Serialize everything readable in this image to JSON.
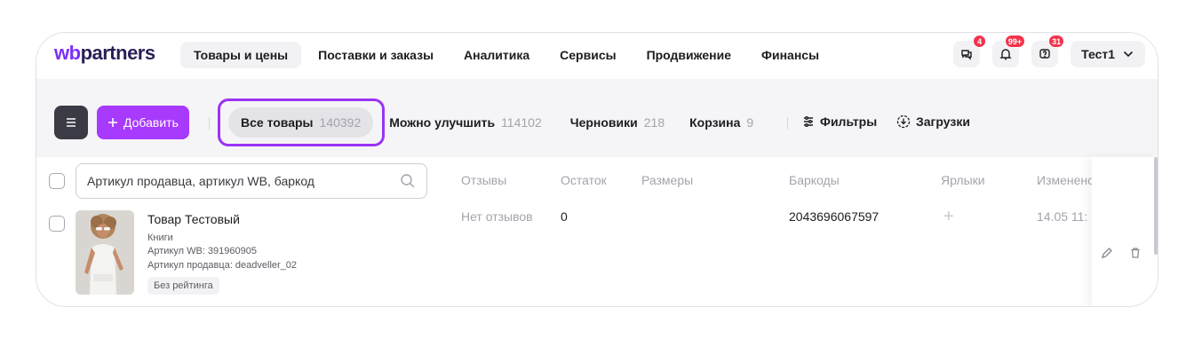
{
  "logo": {
    "part1": "wb",
    "part2": "partners"
  },
  "nav": [
    {
      "label": "Товары и цены",
      "active": true
    },
    {
      "label": "Поставки и заказы",
      "active": false
    },
    {
      "label": "Аналитика",
      "active": false
    },
    {
      "label": "Сервисы",
      "active": false
    },
    {
      "label": "Продвижение",
      "active": false
    },
    {
      "label": "Финансы",
      "active": false
    }
  ],
  "header_icons": [
    {
      "icon": "chat-icon",
      "badge": "4"
    },
    {
      "icon": "bell-icon",
      "badge": "99+"
    },
    {
      "icon": "support-icon",
      "badge": "31"
    }
  ],
  "user": {
    "name": "Тест1"
  },
  "toolbar": {
    "add_label": "Добавить",
    "tabs": [
      {
        "label": "Все товары",
        "count": "140392",
        "active": true
      },
      {
        "label": "Можно улучшить",
        "count": "114102",
        "active": false
      },
      {
        "label": "Черновики",
        "count": "218",
        "active": false
      },
      {
        "label": "Корзина",
        "count": "9",
        "active": false
      }
    ],
    "filters_label": "Фильтры",
    "downloads_label": "Загрузки"
  },
  "table": {
    "search_placeholder": "Артикул продавца, артикул WB, баркод",
    "columns": [
      "Отзывы",
      "Остаток",
      "Размеры",
      "Баркоды",
      "Ярлыки",
      "Изменено"
    ],
    "rows": [
      {
        "title": "Товар Тестовый",
        "category": "Книги",
        "wb_article": "Артикул WB: 391960905",
        "seller_article": "Артикул продавца: deadveller_02",
        "rating": "Без рейтинга",
        "reviews": "Нет отзывов",
        "stock": "0",
        "sizes": "",
        "barcode": "2043696067597",
        "labels": "+",
        "changed": "14.05 11:"
      }
    ]
  },
  "colors": {
    "accent": "#a73afd",
    "highlight": "#9b33f5",
    "badge": "#f2334c"
  }
}
